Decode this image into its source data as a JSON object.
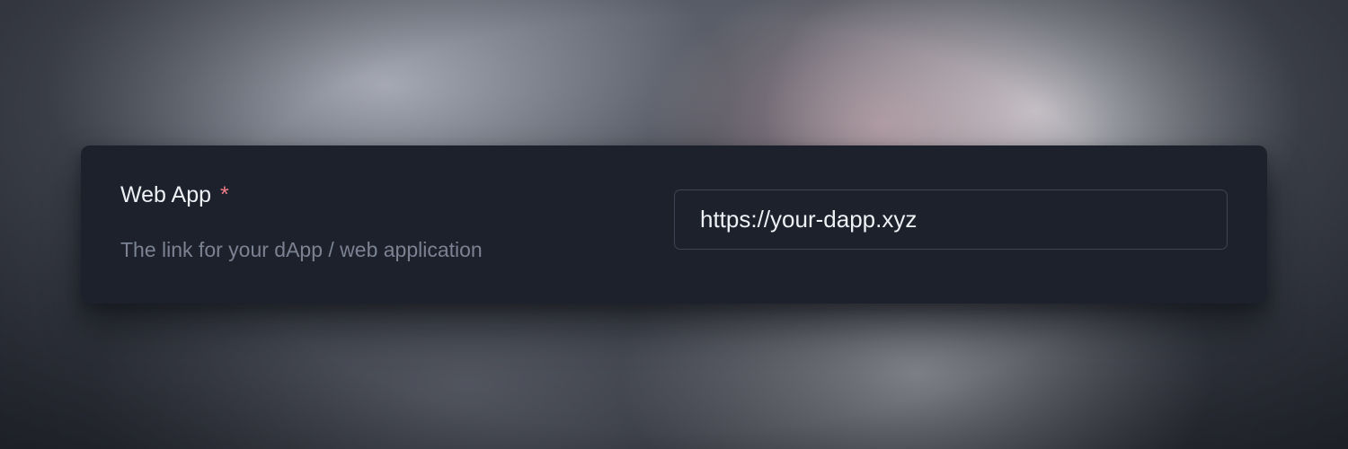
{
  "field": {
    "label": "Web App",
    "required_marker": "*",
    "description": "The link for your dApp / web application",
    "input": {
      "value": "",
      "placeholder": "https://your-dapp.xyz"
    }
  },
  "colors": {
    "card_background": "#1c212c",
    "label_text": "#eef0f4",
    "required_marker": "#f07c86",
    "description_text": "#7b8292",
    "input_border": "#3d4454"
  }
}
